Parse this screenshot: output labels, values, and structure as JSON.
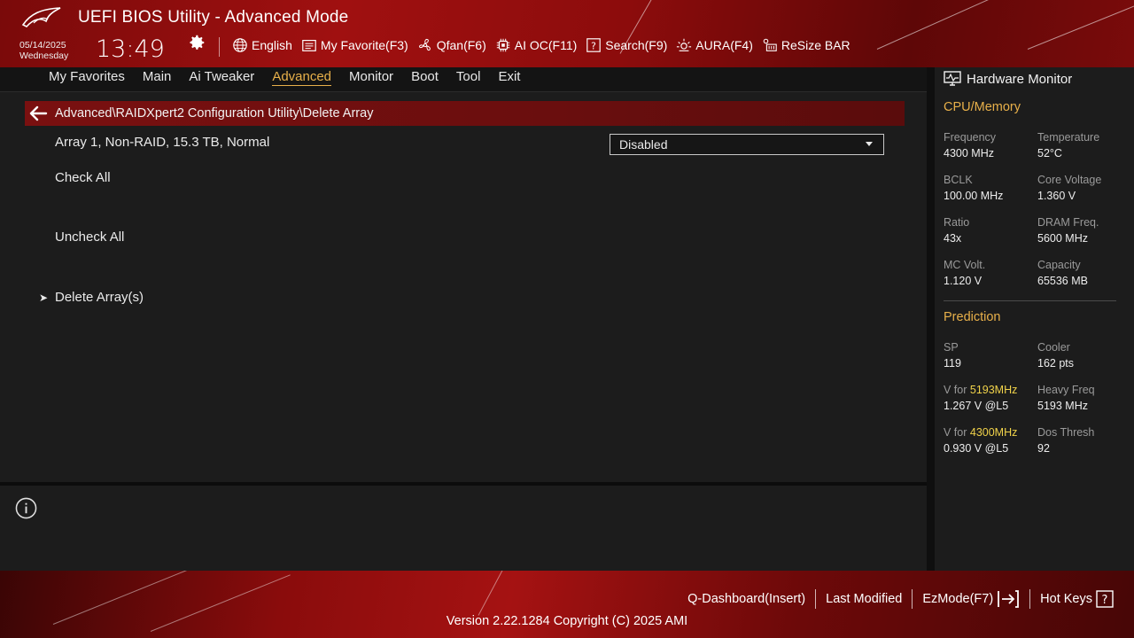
{
  "app": {
    "title": "UEFI BIOS Utility - Advanced Mode"
  },
  "datetime": {
    "date": "05/14/2025",
    "weekday": "Wednesday",
    "time": "13:49"
  },
  "toolbar": [
    {
      "icon": "globe-icon",
      "label": "English"
    },
    {
      "icon": "favorite-list-icon",
      "label": "My Favorite(F3)"
    },
    {
      "icon": "fan-icon",
      "label": "Qfan(F6)"
    },
    {
      "icon": "chip-icon",
      "label": "AI OC(F11)"
    },
    {
      "icon": "question-box-icon",
      "label": "Search(F9)"
    },
    {
      "icon": "aura-light-icon",
      "label": "AURA(F4)"
    },
    {
      "icon": "resize-bar-icon",
      "label": "ReSize BAR"
    }
  ],
  "nav": {
    "tabs": [
      "My Favorites",
      "Main",
      "Ai Tweaker",
      "Advanced",
      "Monitor",
      "Boot",
      "Tool",
      "Exit"
    ],
    "active": "Advanced"
  },
  "main": {
    "breadcrumb": "Advanced\\RAIDXpert2 Configuration Utility\\Delete Array",
    "items": {
      "array": "Array 1, Non-RAID, 15.3 TB, Normal",
      "check_all": "Check All",
      "uncheck_all": "Uncheck All",
      "delete_arrays": "Delete Array(s)"
    },
    "array_select": {
      "value": "Disabled"
    }
  },
  "hw": {
    "title": "Hardware Monitor",
    "cpu_section": "CPU/Memory",
    "cpu": [
      {
        "label": "Frequency",
        "value": "4300 MHz"
      },
      {
        "label": "Temperature",
        "value": "52°C"
      },
      {
        "label": "BCLK",
        "value": "100.00 MHz"
      },
      {
        "label": "Core Voltage",
        "value": "1.360 V"
      },
      {
        "label": "Ratio",
        "value": "43x"
      },
      {
        "label": "DRAM Freq.",
        "value": "5600 MHz"
      },
      {
        "label": "MC Volt.",
        "value": "1.120 V"
      },
      {
        "label": "Capacity",
        "value": "65536 MB"
      }
    ],
    "prediction_section": "Prediction",
    "prediction": {
      "sp_label": "SP",
      "sp_value": "119",
      "cooler_label": "Cooler",
      "cooler_value": "162 pts",
      "vfor_label": "V for ",
      "vfor1_freq": "5193MHz",
      "vfor1_value": "1.267 V @L5",
      "heavy_label": "Heavy Freq",
      "heavy_value": "5193 MHz",
      "vfor2_freq": "4300MHz",
      "vfor2_value": "0.930 V @L5",
      "dos_label": "Dos Thresh",
      "dos_value": "92"
    }
  },
  "footer": {
    "links": [
      "Q-Dashboard(Insert)",
      "Last Modified",
      "EzMode(F7)",
      "Hot Keys"
    ],
    "version": "Version 2.22.1284 Copyright (C) 2025 AMI"
  },
  "colors": {
    "accent": "#e8b04a",
    "highlight": "#f0d24a",
    "header_red": "#a01010"
  }
}
